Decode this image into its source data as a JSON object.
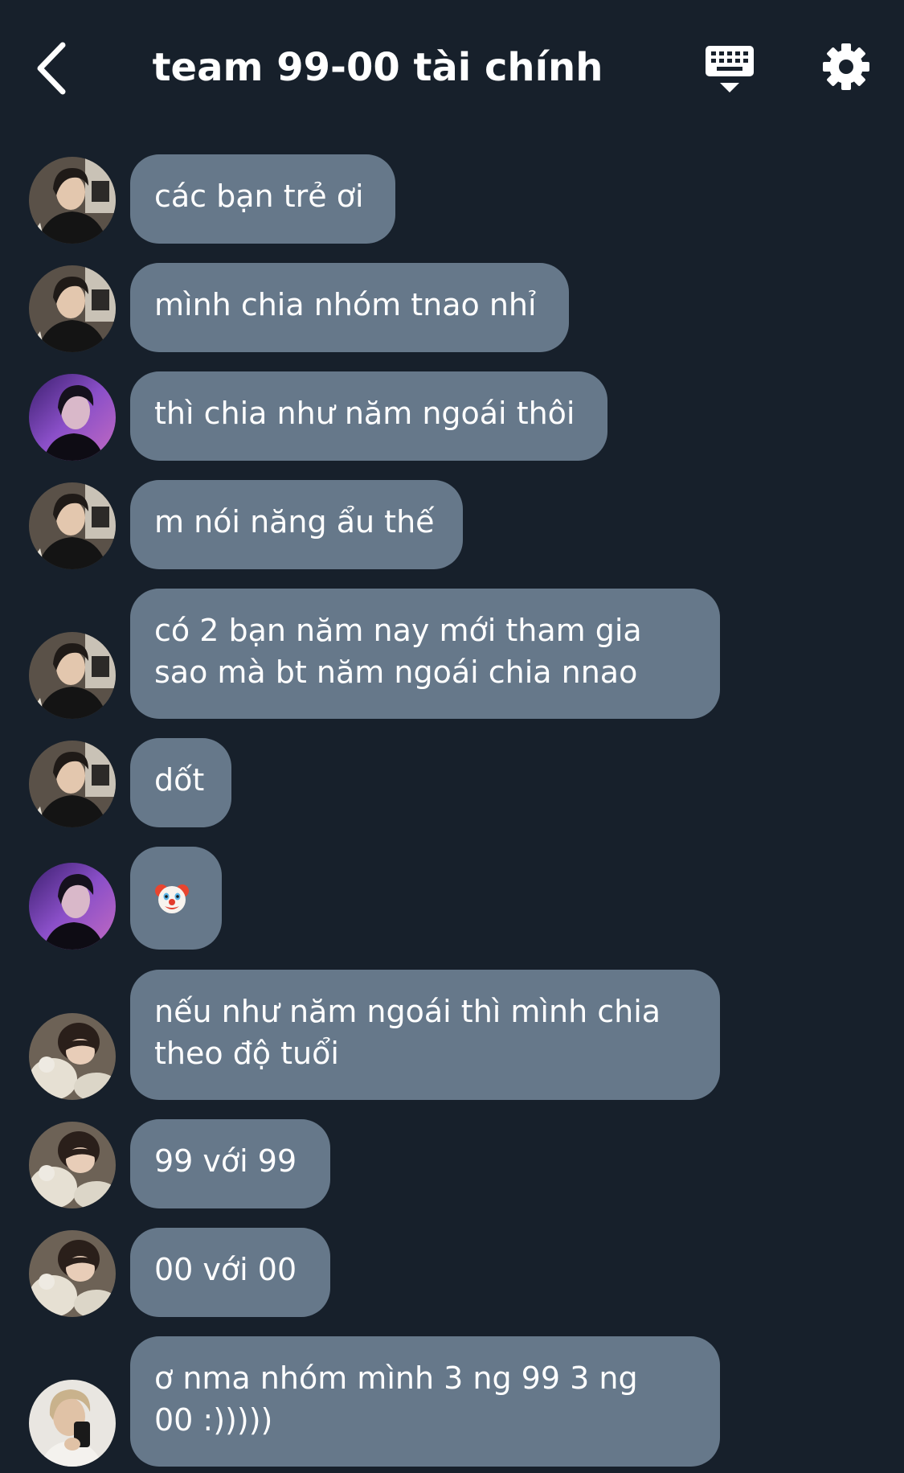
{
  "header": {
    "title": "team 99-00 tài chính",
    "back_icon": "chevron-left-icon",
    "keyboard_icon": "keyboard-hide-icon",
    "settings_icon": "gear-icon"
  },
  "colors": {
    "background": "#17202b",
    "bubble": "#66788a",
    "text": "#ffffff"
  },
  "messages": [
    {
      "avatar": "user-a",
      "text": "các bạn trẻ ơi"
    },
    {
      "avatar": "user-a",
      "text": "mình chia nhóm tnao nhỉ"
    },
    {
      "avatar": "user-b",
      "text": "thì chia như năm ngoái thôi"
    },
    {
      "avatar": "user-a",
      "text": "m nói năng ẩu thế"
    },
    {
      "avatar": "user-a",
      "text": "có 2 bạn năm nay mới tham gia\nsao mà bt năm ngoái chia nnao"
    },
    {
      "avatar": "user-a",
      "text": "dốt"
    },
    {
      "avatar": "user-b",
      "text": "🤡",
      "emoji": "clown-face"
    },
    {
      "avatar": "user-c",
      "text": "nếu như năm ngoái thì mình chia\ntheo độ tuổi"
    },
    {
      "avatar": "user-c",
      "text": "99 với 99"
    },
    {
      "avatar": "user-c",
      "text": "00 với 00"
    },
    {
      "avatar": "user-d",
      "text": "ơ nma nhóm mình 3 ng 99 3 ng\n00 :)))))"
    }
  ]
}
